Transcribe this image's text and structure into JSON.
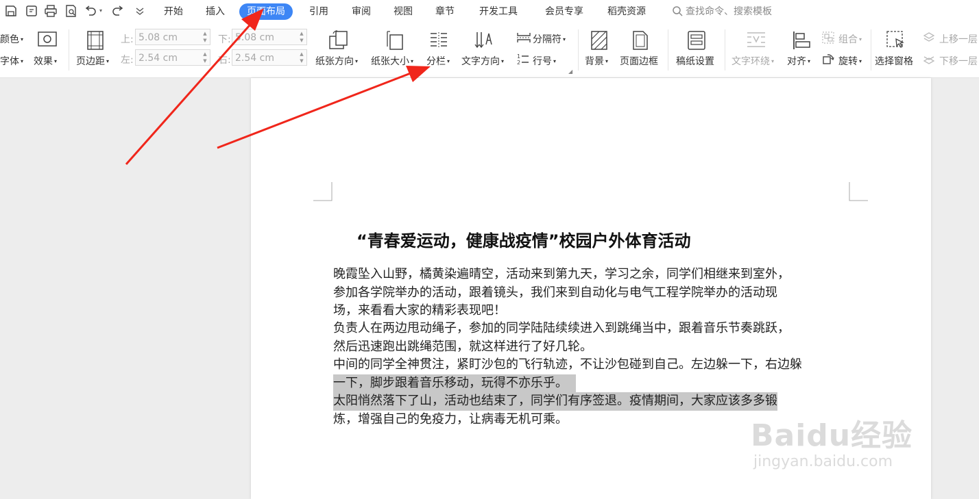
{
  "menu": {
    "tabs": [
      "开始",
      "插入",
      "页面布局",
      "引用",
      "审阅",
      "视图",
      "章节",
      "开发工具",
      "会员专享",
      "稻壳资源"
    ],
    "active_tab": "页面布局",
    "search_placeholder": "查找命令、搜索模板"
  },
  "ribbon": {
    "color_label": "颜色",
    "font_label": "字体",
    "effect_label": "效果",
    "margin_label": "页边距",
    "margin_top_label": "上:",
    "margin_top_value": "5.08 cm",
    "margin_bottom_label": "下:",
    "margin_bottom_value": "5.08 cm",
    "margin_left_label": "左:",
    "margin_left_value": "2.54 cm",
    "margin_right_label": "右:",
    "margin_right_value": "2.54 cm",
    "orientation_label": "纸张方向",
    "size_label": "纸张大小",
    "columns_label": "分栏",
    "text_direction_label": "文字方向",
    "separator_label": "分隔符",
    "line_number_label": "行号",
    "background_label": "背景",
    "page_border_label": "页面边框",
    "manuscript_label": "稿纸设置",
    "wrap_label": "文字环绕",
    "align_label": "对齐",
    "group_label": "组合",
    "rotate_label": "旋转",
    "select_pane_label": "选择窗格",
    "bring_forward_label": "上移一层",
    "send_backward_label": "下移一层"
  },
  "document": {
    "title": "“青春爱运动，健康战疫情”校园户外体育活动",
    "p1_l1": "晚霞坠入山野，橘黄染遍晴空，活动来到第九天，学习之余，同学们相继来到室外，",
    "p1_l2": "参加各学院举办的活动，跟着镜头，我们来到自动化与电气工程学院举办的活动现",
    "p1_l3": "场，来看看大家的精彩表现吧！",
    "p2_l1": "负责人在两边甩动绳子，参加的同学陆陆续续进入到跳绳当中，跟着音乐节奏跳跃，",
    "p2_l2": "然后迅速跑出跳绳范围，就这样进行了好几轮。",
    "p3_l1": "中间的同学全神贯注，紧盯沙包的飞行轨迹，不让沙包碰到自己。左边躲一下，右边躲",
    "p3_l2": "一下，脚步跟着音乐移动，玩得不亦乐乎。",
    "p4_l1": "太阳悄然落下了山，活动也结束了，同学们有序签退。疫情期间，大家应该多多锻",
    "p4_l2": "炼，增强自己的免疫力，让病毒无机可乘。"
  },
  "watermark": {
    "brand": "Baidu经验",
    "url": "jingyan.baidu.com"
  },
  "colors": {
    "accent": "#3d86f5",
    "arrow": "#f0261b",
    "highlight": "#c8c8c8"
  }
}
